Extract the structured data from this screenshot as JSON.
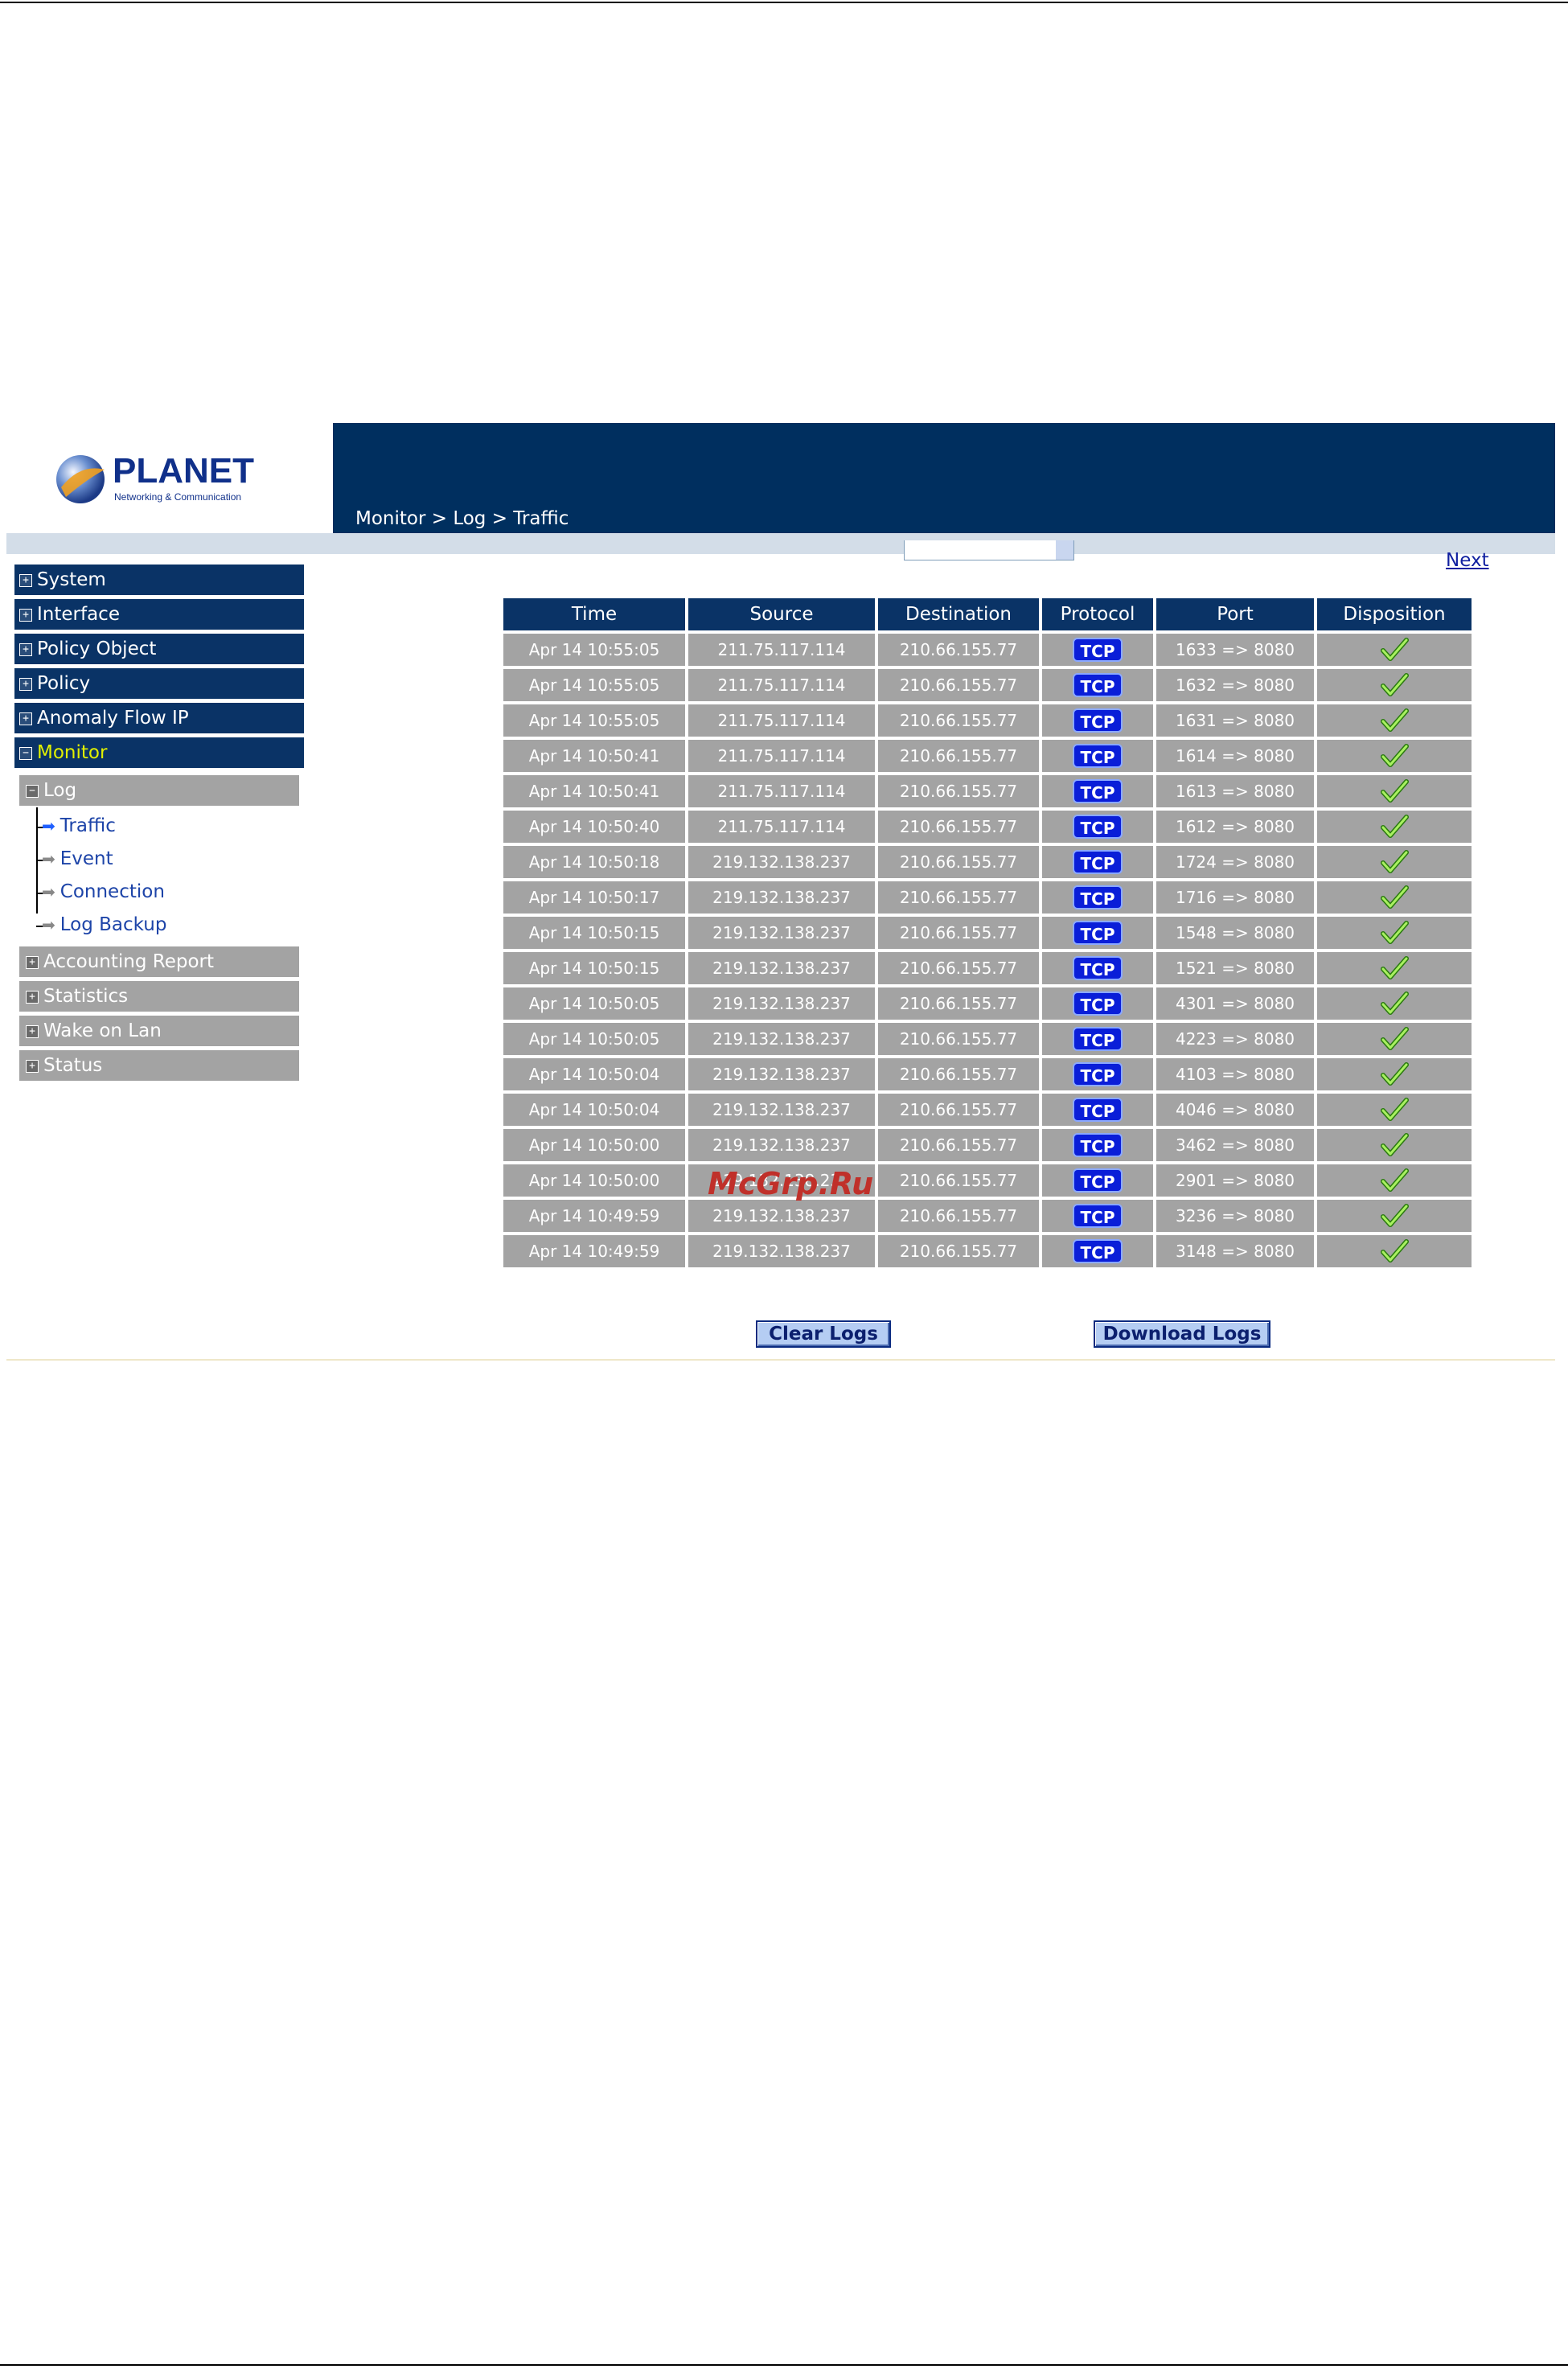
{
  "breadcrumb": "Monitor > Log > Traffic",
  "logo": {
    "brand": "PLANET",
    "tagline": "Networking & Communication"
  },
  "sidebar": {
    "main": [
      "System",
      "Interface",
      "Policy Object",
      "Policy",
      "Anomaly Flow IP",
      "Monitor"
    ],
    "log_label": "Log",
    "log_items": [
      "Traffic",
      "Event",
      "Connection",
      "Log Backup"
    ],
    "other": [
      "Accounting Report",
      "Statistics",
      "Wake on Lan",
      "Status"
    ]
  },
  "next_label": "Next",
  "table": {
    "headers": [
      "Time",
      "Source",
      "Destination",
      "Protocol",
      "Port",
      "Disposition"
    ],
    "protocol_label": "TCP",
    "rows": [
      [
        "Apr 14 10:55:05",
        "211.75.117.114",
        "210.66.155.77",
        "1633 => 8080"
      ],
      [
        "Apr 14 10:55:05",
        "211.75.117.114",
        "210.66.155.77",
        "1632 => 8080"
      ],
      [
        "Apr 14 10:55:05",
        "211.75.117.114",
        "210.66.155.77",
        "1631 => 8080"
      ],
      [
        "Apr 14 10:50:41",
        "211.75.117.114",
        "210.66.155.77",
        "1614 => 8080"
      ],
      [
        "Apr 14 10:50:41",
        "211.75.117.114",
        "210.66.155.77",
        "1613 => 8080"
      ],
      [
        "Apr 14 10:50:40",
        "211.75.117.114",
        "210.66.155.77",
        "1612 => 8080"
      ],
      [
        "Apr 14 10:50:18",
        "219.132.138.237",
        "210.66.155.77",
        "1724 => 8080"
      ],
      [
        "Apr 14 10:50:17",
        "219.132.138.237",
        "210.66.155.77",
        "1716 => 8080"
      ],
      [
        "Apr 14 10:50:15",
        "219.132.138.237",
        "210.66.155.77",
        "1548 => 8080"
      ],
      [
        "Apr 14 10:50:15",
        "219.132.138.237",
        "210.66.155.77",
        "1521 => 8080"
      ],
      [
        "Apr 14 10:50:05",
        "219.132.138.237",
        "210.66.155.77",
        "4301 => 8080"
      ],
      [
        "Apr 14 10:50:05",
        "219.132.138.237",
        "210.66.155.77",
        "4223 => 8080"
      ],
      [
        "Apr 14 10:50:04",
        "219.132.138.237",
        "210.66.155.77",
        "4103 => 8080"
      ],
      [
        "Apr 14 10:50:04",
        "219.132.138.237",
        "210.66.155.77",
        "4046 => 8080"
      ],
      [
        "Apr 14 10:50:00",
        "219.132.138.237",
        "210.66.155.77",
        "3462 => 8080"
      ],
      [
        "Apr 14 10:50:00",
        "219.132.138.237",
        "210.66.155.77",
        "2901 => 8080"
      ],
      [
        "Apr 14 10:49:59",
        "219.132.138.237",
        "210.66.155.77",
        "3236 => 8080"
      ],
      [
        "Apr 14 10:49:59",
        "219.132.138.237",
        "210.66.155.77",
        "3148 => 8080"
      ]
    ]
  },
  "buttons": {
    "clear": "Clear Logs",
    "download": "Download Logs"
  },
  "watermark": "McGrp.Ru",
  "icons": {
    "protocol": "tcp-badge-icon",
    "disposition": "check-icon",
    "tree_arrow": "arrow-right-icon"
  },
  "colors": {
    "header": "#002f5f",
    "nav": "#0a3366",
    "row": "#a3a3a3",
    "active_nav": "#e0f000"
  }
}
